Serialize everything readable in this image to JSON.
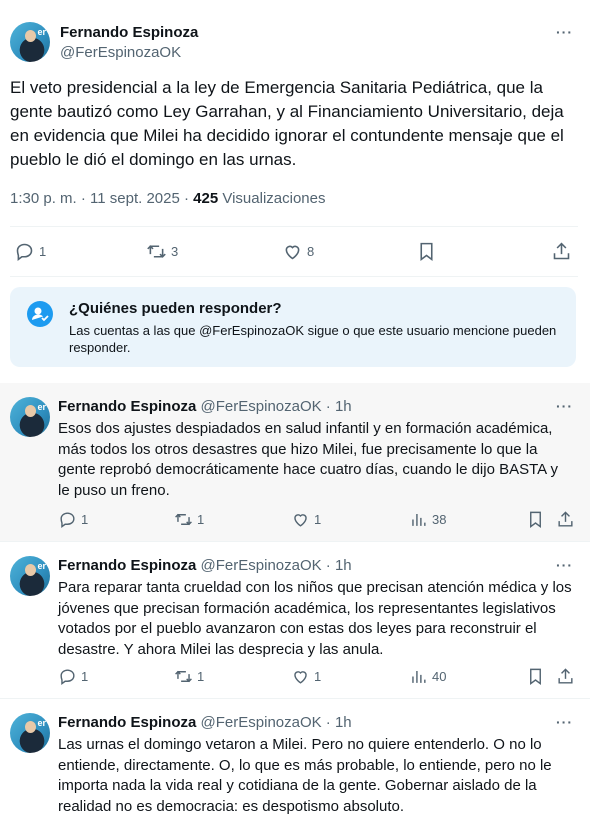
{
  "main_tweet": {
    "author_name": "Fernando Espinoza",
    "handle": "@FerEspinozaOK",
    "avatar_text": "er",
    "text": "El veto presidencial a la ley de Emergencia Sanitaria Pediátrica, que la gente bautizó como Ley Garrahan, y al Financiamiento Universitario, deja en evidencia que Milei ha decidido ignorar el contundente mensaje que el pueblo le dió el domingo en las urnas.",
    "time": "1:30 p. m. · 11 sept. 2025 · ",
    "views_count": "425",
    "views_label": " Visualizaciones",
    "more": "···",
    "replies": "1",
    "retweets": "3",
    "likes": "8"
  },
  "reply_restriction": {
    "title": "¿Quiénes pueden responder?",
    "description": "Las cuentas a las que @FerEspinozaOK sigue o que este usuario mencione pueden responder."
  },
  "replies": [
    {
      "name": "Fernando Espinoza",
      "handle": "@FerEspinozaOK · 1h",
      "text": "Esos dos ajustes despiadados en salud infantil y en formación académica, más todos los otros desastres que hizo Milei, fue precisamente lo que la gente reprobó democráticamente hace cuatro días, cuando le dijo BASTA y le puso un freno.",
      "replies": "1",
      "retweets": "1",
      "likes": "1",
      "views": "38"
    },
    {
      "name": "Fernando Espinoza",
      "handle": "@FerEspinozaOK · 1h",
      "text": "Para reparar tanta crueldad con los niños que precisan atención médica y los jóvenes que precisan formación académica, los representantes legislativos votados por el pueblo avanzaron con estas dos leyes para reconstruir el desastre. Y ahora Milei las desprecia y las anula.",
      "replies": "1",
      "retweets": "1",
      "likes": "1",
      "views": "40"
    },
    {
      "name": "Fernando Espinoza",
      "handle": "@FerEspinozaOK · 1h",
      "text": "Las urnas el domingo vetaron a Milei. Pero no quiere entenderlo. O no lo entiende, directamente. O, lo que es más probable, lo entiende, pero no le importa nada la vida real y cotidiana de la gente. Gobernar aislado de la realidad no es democracia: es despotismo absoluto."
    }
  ],
  "colors": {
    "accent": "#1d9bf0",
    "muted": "#536471",
    "text": "#0f1419",
    "highlight_bg": "#f7f7f7",
    "reply_box_bg": "#eaf4fb"
  }
}
